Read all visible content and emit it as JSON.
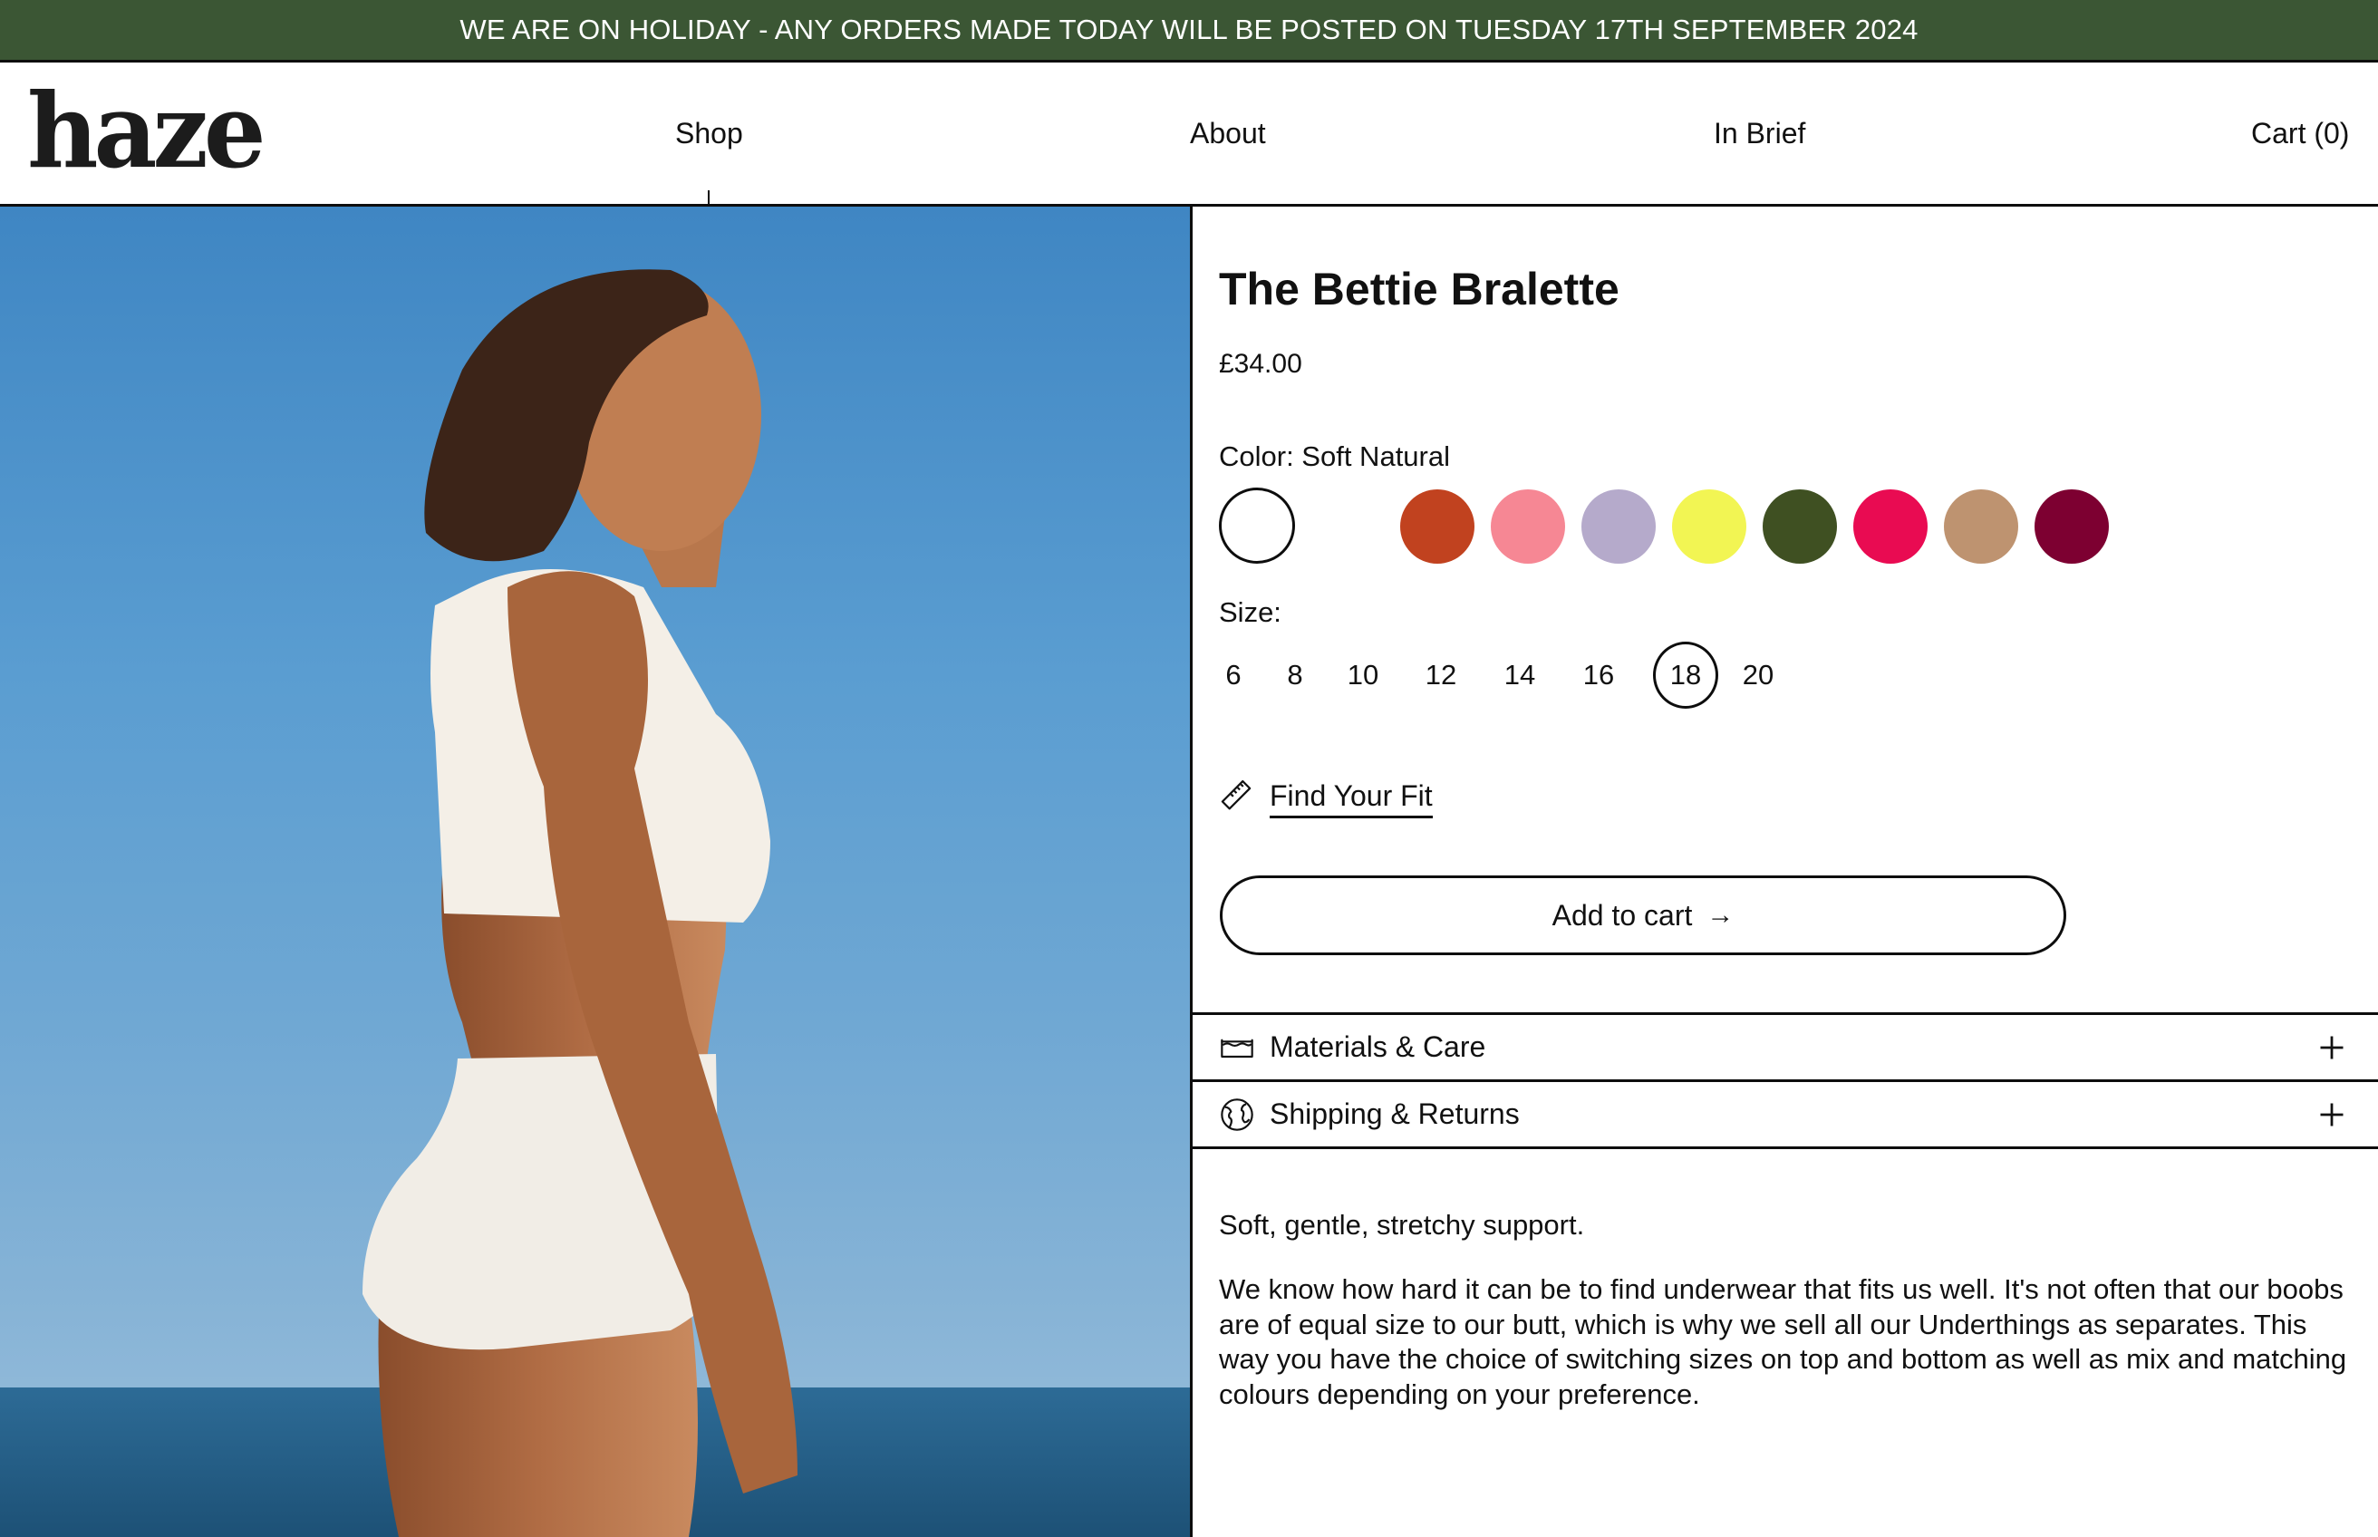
{
  "banner": {
    "text": "WE ARE ON HOLIDAY - ANY ORDERS MADE TODAY WILL BE POSTED ON TUESDAY 17TH SEPTEMBER 2024",
    "background": "#3b5634"
  },
  "header": {
    "logo": "haze",
    "nav": [
      {
        "label": "Shop",
        "active": true
      },
      {
        "label": "About"
      },
      {
        "label": "In Brief"
      },
      {
        "label": "Cart (0)"
      }
    ]
  },
  "hero": {
    "icon": "product-photo",
    "alt": "Woman in profile wearing the Bettie Bralette and high-waisted briefs by the sea"
  },
  "product": {
    "title": "The Bettie Bralette",
    "price": "£34.00",
    "color_label": "Color: Soft Natural",
    "selected_color": "Soft Natural",
    "swatches": [
      {
        "color": "#ffffff",
        "selected": true
      },
      {
        "color": "#ffffff"
      },
      {
        "color": "#c1421f"
      },
      {
        "color": "#f68794"
      },
      {
        "color": "#b5aacb"
      },
      {
        "color": "#f2f553"
      },
      {
        "color": "#3f5022"
      },
      {
        "color": "#e90b52"
      },
      {
        "color": "#be9370"
      },
      {
        "color": "#7d0031"
      }
    ],
    "size_label": "Size:",
    "sizes": [
      "6",
      "8",
      "10",
      "12",
      "14",
      "16",
      "18",
      "20"
    ],
    "selected_size": "18",
    "fit_link": {
      "label": "Find Your Fit",
      "icon": "ruler-icon"
    },
    "add_to_cart": {
      "label": "Add to cart",
      "icon": "→"
    },
    "accordions": [
      {
        "label": "Materials & Care",
        "icon": "wash-basin-icon",
        "toggle": "+"
      },
      {
        "label": "Shipping & Returns",
        "icon": "globe-icon",
        "toggle": "+"
      }
    ],
    "description_short": "Soft, gentle, stretchy support.",
    "description_long": "We know how hard it can be to find underwear that fits us well. It's not often that our boobs are of equal size to our butt, which is why we sell all our Underthings as separates. This way you have the choice of switching sizes on top and bottom as well as mix and matching colours depending on your preference."
  }
}
